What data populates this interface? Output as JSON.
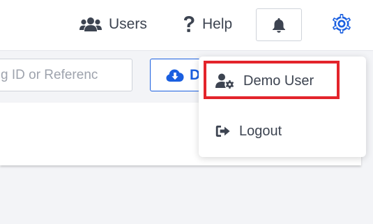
{
  "header": {
    "users_label": "Users",
    "help_label": "Help"
  },
  "toolbar": {
    "search_placeholder": "g ID or Referenc",
    "download_label": "D"
  },
  "user_menu": {
    "items": [
      {
        "label": "Demo User",
        "icon": "user-gear-icon"
      },
      {
        "label": "Logout",
        "icon": "sign-out-icon"
      }
    ]
  },
  "colors": {
    "accent": "#1a5fe0",
    "highlight": "#e3242b",
    "text": "#3d4451"
  }
}
